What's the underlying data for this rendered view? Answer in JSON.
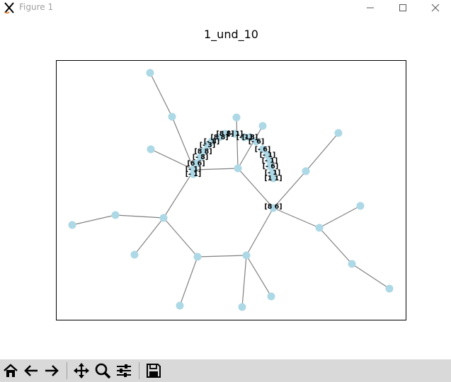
{
  "window": {
    "title": "Figure 1"
  },
  "plot": {
    "title": "1_und_10"
  },
  "graph": {
    "node_color": "#add8e6",
    "edge_color": "#808080",
    "labels": [
      {
        "text": "[8 6]"
      },
      {
        "text": "[- 1]"
      },
      {
        "text": "[- 1]"
      },
      {
        "text": "[6 6]"
      },
      {
        "text": "[- 8]"
      },
      {
        "text": "[8 8]"
      },
      {
        "text": "[- 3]"
      },
      {
        "text": "[- 8]"
      },
      {
        "text": "[8 8]"
      },
      {
        "text": "[8 8]"
      },
      {
        "text": "[- 1]"
      },
      {
        "text": "[- 1]"
      },
      {
        "text": "[- 8]"
      },
      {
        "text": "[- 6]"
      },
      {
        "text": "[- 6]"
      },
      {
        "text": "[- 1]"
      },
      {
        "text": "[- 1]"
      },
      {
        "text": "[- 6]"
      },
      {
        "text": "[- 1]"
      },
      {
        "text": "[1 1]"
      }
    ]
  },
  "toolbar": {
    "buttons": [
      {
        "icon": "home-icon"
      },
      {
        "icon": "back-arrow-icon"
      },
      {
        "icon": "forward-arrow-icon"
      },
      {
        "icon": "pan-icon"
      },
      {
        "icon": "zoom-icon"
      },
      {
        "icon": "configure-subplots-icon"
      },
      {
        "icon": "save-icon"
      }
    ]
  }
}
